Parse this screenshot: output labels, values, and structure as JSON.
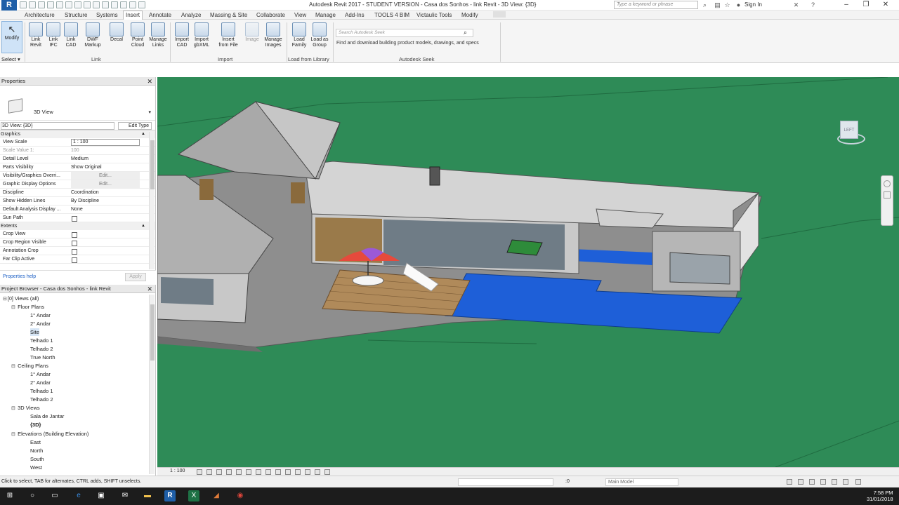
{
  "window": {
    "title": "Autodesk Revit 2017 - STUDENT VERSION -    Casa dos Sonhos - link Revit - 3D View: {3D}",
    "search_placeholder": "Type a keyword or phrase",
    "sign_in": "Sign In"
  },
  "menu_tabs": [
    "Architecture",
    "Structure",
    "Systems",
    "Insert",
    "Annotate",
    "Analyze",
    "Massing & Site",
    "Collaborate",
    "View",
    "Manage",
    "Add-Ins",
    "TOOLS 4 BIM",
    "Victaulic Tools",
    "Modify"
  ],
  "active_tab": "Insert",
  "ribbon": {
    "modify": "Modify",
    "select": "Select",
    "buttons": [
      {
        "label1": "Link",
        "label2": "Revit"
      },
      {
        "label1": "Link",
        "label2": "IFC"
      },
      {
        "label1": "Link",
        "label2": "CAD"
      },
      {
        "label1": "DWF",
        "label2": "Markup"
      },
      {
        "label1": "Decal",
        "label2": ""
      },
      {
        "label1": "Point",
        "label2": "Cloud"
      },
      {
        "label1": "Manage",
        "label2": "Links"
      },
      {
        "label1": "Import",
        "label2": "CAD"
      },
      {
        "label1": "Import",
        "label2": "gbXML"
      },
      {
        "label1": "Insert",
        "label2": "from File"
      },
      {
        "label1": "Image",
        "label2": ""
      },
      {
        "label1": "Manage",
        "label2": "Images"
      },
      {
        "label1": "Load",
        "label2": "Family"
      },
      {
        "label1": "Load as",
        "label2": "Group"
      }
    ],
    "groups": {
      "link": "Link",
      "import": "Import",
      "load": "Load from Library",
      "seek": "Autodesk Seek"
    },
    "seek_placeholder": "Search Autodesk Seek",
    "seek_description": "Find and download building product models, drawings, and specs"
  },
  "properties": {
    "title": "Properties",
    "type_name": "3D View",
    "view_selector": "3D View: {3D}",
    "edit_type": "Edit Type",
    "group_graphics": "Graphics",
    "rows": [
      {
        "key": "View Scale",
        "value": "1 : 100"
      },
      {
        "key": "Scale Value    1:",
        "value": "100"
      },
      {
        "key": "Detail Level",
        "value": "Medium"
      },
      {
        "key": "Parts Visibility",
        "value": "Show Original"
      },
      {
        "key": "Visibility/Graphics Overri...",
        "value": "Edit..."
      },
      {
        "key": "Graphic Display Options",
        "value": "Edit..."
      },
      {
        "key": "Discipline",
        "value": "Coordination"
      },
      {
        "key": "Show Hidden Lines",
        "value": "By Discipline"
      },
      {
        "key": "Default Analysis Display ...",
        "value": "None"
      },
      {
        "key": "Sun Path",
        "value": ""
      }
    ],
    "group_extents": "Extents",
    "extent_rows": [
      "Crop View",
      "Crop Region Visible",
      "Annotation Crop",
      "Far Clip Active"
    ],
    "help": "Properties help",
    "apply": "Apply"
  },
  "browser": {
    "title": "Project Browser - Casa dos Sonhos - link Revit",
    "views_all": "Views (all)",
    "floor_plans": "Floor Plans",
    "floor_items": [
      "1° Andar",
      "2° Andar",
      "Site",
      "Telhado 1",
      "Telhado 2",
      "True North"
    ],
    "ceiling_plans": "Ceiling Plans",
    "ceiling_items": [
      "1° Andar",
      "2° Andar",
      "Telhado 1",
      "Telhado 2"
    ],
    "views_3d": "3D Views",
    "views_3d_items": [
      "Sala de Jantar",
      "{3D}"
    ],
    "elevations": "Elevations (Building Elevation)",
    "elevation_items": [
      "East",
      "North",
      "South",
      "West"
    ]
  },
  "viewport": {
    "viewcube_label": "LEFT"
  },
  "view_control": {
    "scale": "1 : 100"
  },
  "status": {
    "text": "Click to select, TAB for alternates, CTRL adds, SHIFT unselects.",
    "filter_count": ":0",
    "model": "Main Model"
  },
  "taskbar": {
    "time": "7:58 PM",
    "date": "31/01/2018"
  },
  "colors": {
    "terrain": "#2e8b57",
    "pool": "#1e5fd8",
    "ribbon_bg": "#f5f5f5",
    "revit_blue": "#1f5fa8"
  }
}
